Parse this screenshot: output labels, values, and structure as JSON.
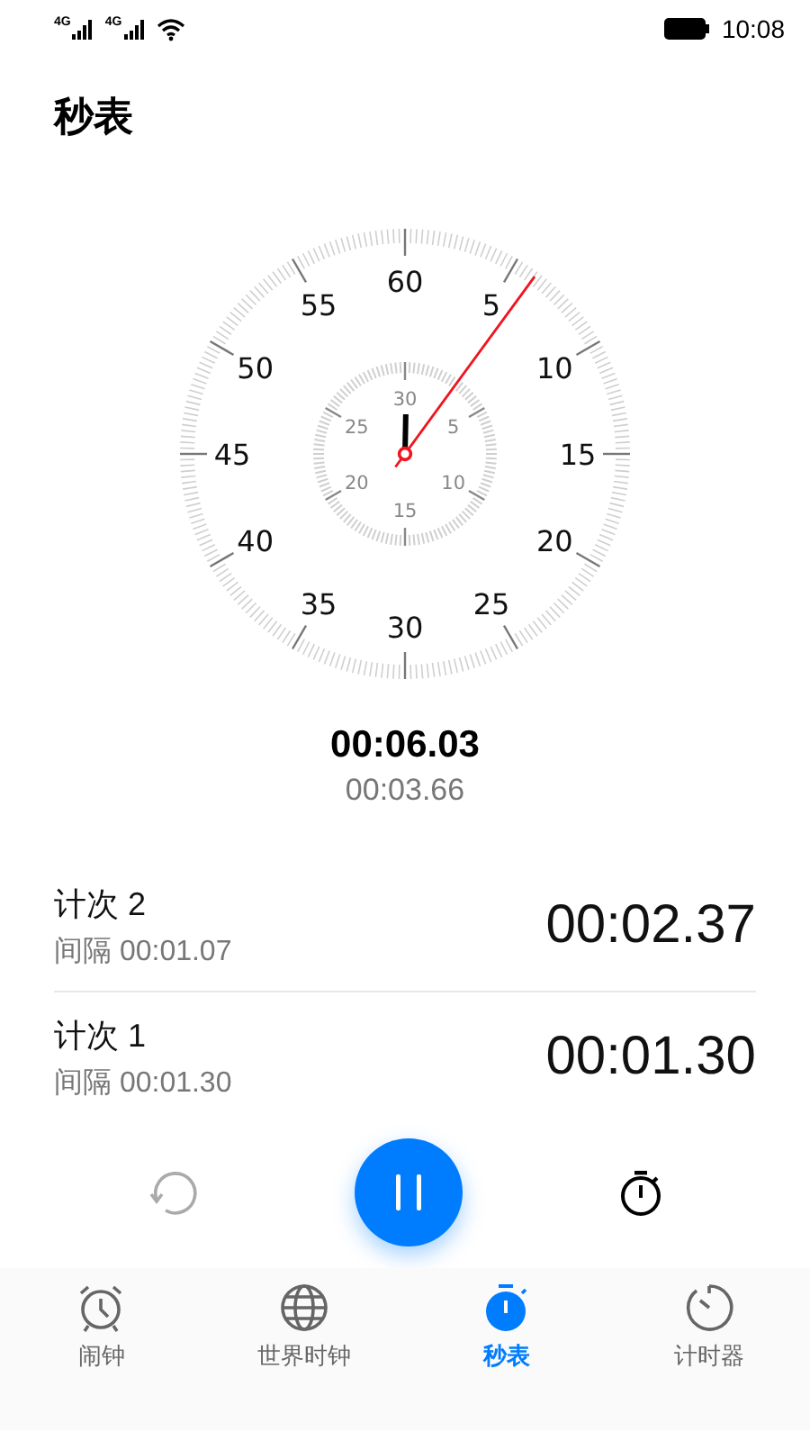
{
  "status_bar": {
    "network_1": "4G",
    "network_2": "4G",
    "time": "10:08"
  },
  "title": "秒表",
  "dial": {
    "outer_numbers": [
      "60",
      "5",
      "10",
      "15",
      "20",
      "25",
      "30",
      "35",
      "40",
      "45",
      "50",
      "55"
    ],
    "inner_numbers": [
      "30",
      "5",
      "10",
      "15",
      "20",
      "25"
    ]
  },
  "total_time": "00:06.03",
  "lap_time": "00:03.66",
  "laps": [
    {
      "label": "计次 2",
      "interval": "间隔 00:01.07",
      "time": "00:02.37"
    },
    {
      "label": "计次 1",
      "interval": "间隔 00:01.30",
      "time": "00:01.30"
    }
  ],
  "controls": {
    "reset_disabled": true,
    "running": true
  },
  "tabs": [
    {
      "label": "闹钟",
      "selected": false
    },
    {
      "label": "世界时钟",
      "selected": false
    },
    {
      "label": "秒表",
      "selected": true
    },
    {
      "label": "计时器",
      "selected": false
    }
  ]
}
